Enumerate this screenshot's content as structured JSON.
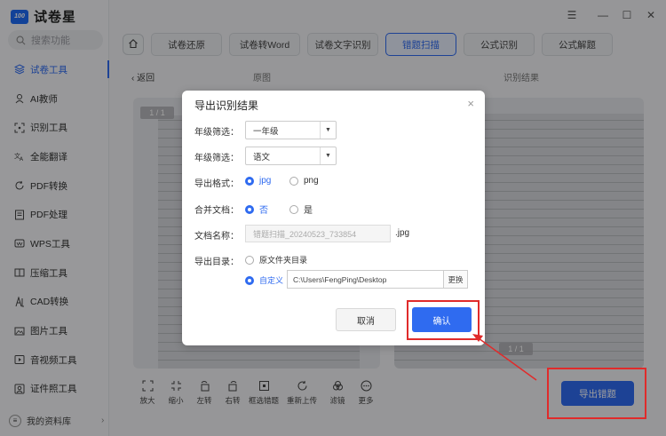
{
  "app": {
    "name": "试卷星",
    "logo_badge": "100"
  },
  "search": {
    "placeholder": "搜索功能"
  },
  "sidebar": {
    "items": [
      {
        "label": "试卷工具",
        "icon": "layers-icon",
        "active": true
      },
      {
        "label": "AI教师",
        "icon": "robot-icon"
      },
      {
        "label": "识别工具",
        "icon": "scan-icon"
      },
      {
        "label": "全能翻译",
        "icon": "translate-icon"
      },
      {
        "label": "PDF转换",
        "icon": "refresh-icon"
      },
      {
        "label": "PDF处理",
        "icon": "pdf-icon"
      },
      {
        "label": "WPS工具",
        "icon": "wps-icon"
      },
      {
        "label": "压缩工具",
        "icon": "compress-icon"
      },
      {
        "label": "CAD转换",
        "icon": "cad-icon"
      },
      {
        "label": "图片工具",
        "icon": "image-icon"
      },
      {
        "label": "音视频工具",
        "icon": "video-icon"
      },
      {
        "label": "证件照工具",
        "icon": "id-photo-icon"
      }
    ],
    "library": "我的资料库"
  },
  "tabs": [
    {
      "label": "试卷还原"
    },
    {
      "label": "试卷转Word"
    },
    {
      "label": "试卷文字识别"
    },
    {
      "label": "错题扫描",
      "active": true
    },
    {
      "label": "公式识别"
    },
    {
      "label": "公式解题"
    }
  ],
  "content": {
    "back_label": "返回",
    "original_label": "原图",
    "result_label": "识别结果",
    "page_badge_left": "1 / 1",
    "page_badge_right": "1 / 1"
  },
  "toolbar": [
    {
      "label": "放大",
      "icon": "zoom-in-icon"
    },
    {
      "label": "缩小",
      "icon": "zoom-out-icon"
    },
    {
      "label": "左转",
      "icon": "rotate-left-icon"
    },
    {
      "label": "右转",
      "icon": "rotate-right-icon"
    },
    {
      "label": "框选错题",
      "icon": "select-box-icon"
    },
    {
      "label": "重新上传",
      "icon": "reupload-icon"
    },
    {
      "label": "滤镜",
      "icon": "filter-icon"
    },
    {
      "label": "更多",
      "icon": "more-icon"
    }
  ],
  "export_button": "导出错题",
  "dialog": {
    "title": "导出识别结果",
    "grade_label": "年级筛选：",
    "grade_value": "一年级",
    "subject_label": "年级筛选：",
    "subject_value": "语文",
    "format_label": "导出格式：",
    "format_options": [
      "jpg",
      "png"
    ],
    "format_selected": "jpg",
    "merge_label": "合并文档：",
    "merge_options": [
      "否",
      "是"
    ],
    "merge_selected": "否",
    "filename_label": "文档名称：",
    "filename_placeholder": "错题扫描_20240523_733854",
    "filename_ext": ".jpg",
    "dir_label": "导出目录：",
    "dir_option_source": "原文件夹目录",
    "dir_option_custom": "自定义",
    "dir_path": "C:\\Users\\FengPing\\Desktop",
    "change_label": "更换",
    "cancel_label": "取消",
    "confirm_label": "确认"
  },
  "colors": {
    "accent": "#2f6bf0",
    "highlight": "#e02b2b"
  }
}
